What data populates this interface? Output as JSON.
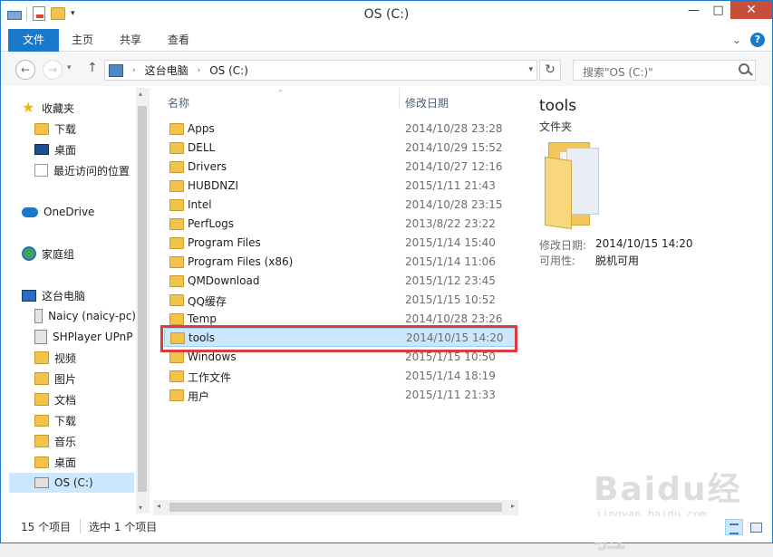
{
  "window": {
    "title": "OS (C:)"
  },
  "qat": {
    "dropdown_glyph": "▾"
  },
  "window_buttons": {
    "minimize": "—",
    "maximize": "□",
    "close": "✕"
  },
  "ribbon": {
    "tabs": [
      {
        "label": "文件"
      },
      {
        "label": "主页"
      },
      {
        "label": "共享"
      },
      {
        "label": "查看"
      }
    ],
    "expand_glyph": "⌄",
    "help_glyph": "?"
  },
  "address": {
    "back_glyph": "←",
    "forward_glyph": "→",
    "recent_dropdown_glyph": "▾",
    "up_glyph": "↑",
    "path": [
      "这台电脑",
      "OS (C:)"
    ],
    "chevron": "›",
    "dropdown_glyph": "▾",
    "refresh_glyph": "↻",
    "search_placeholder": "搜索\"OS (C:)\""
  },
  "navpane": {
    "items": [
      {
        "label": "收藏夹",
        "icon": "star-icon"
      },
      {
        "label": "下载",
        "icon": "folder-icon"
      },
      {
        "label": "桌面",
        "icon": "desktop-icon"
      },
      {
        "label": "最近访问的位置",
        "icon": "recent-places-icon"
      },
      {
        "label": "OneDrive",
        "icon": "onedrive-icon"
      },
      {
        "label": "家庭组",
        "icon": "homegroup-icon"
      },
      {
        "label": "这台电脑",
        "icon": "computer-icon"
      },
      {
        "label": "Naicy (naicy-pc)",
        "icon": "media-device-icon"
      },
      {
        "label": "SHPlayer UPnP",
        "icon": "media-device-icon"
      },
      {
        "label": "视频",
        "icon": "videos-folder-icon"
      },
      {
        "label": "图片",
        "icon": "pictures-folder-icon"
      },
      {
        "label": "文档",
        "icon": "documents-folder-icon"
      },
      {
        "label": "下载",
        "icon": "downloads-folder-icon"
      },
      {
        "label": "音乐",
        "icon": "music-folder-icon"
      },
      {
        "label": "桌面",
        "icon": "desktop-folder-icon"
      },
      {
        "label": "OS (C:)",
        "icon": "drive-icon"
      }
    ],
    "scroll_up_glyph": "▴",
    "scroll_down_glyph": "▾"
  },
  "filelist": {
    "columns": {
      "name": "名称",
      "date": "修改日期",
      "sort_glyph": "^"
    },
    "rows": [
      {
        "name": "Apps",
        "date": "2014/10/28 23:28"
      },
      {
        "name": "DELL",
        "date": "2014/10/29 15:52"
      },
      {
        "name": "Drivers",
        "date": "2014/10/27 12:16"
      },
      {
        "name": "HUBDNZI",
        "date": "2015/1/11 21:43"
      },
      {
        "name": "Intel",
        "date": "2014/10/28 23:15"
      },
      {
        "name": "PerfLogs",
        "date": "2013/8/22 23:22"
      },
      {
        "name": "Program Files",
        "date": "2015/1/14 15:40"
      },
      {
        "name": "Program Files (x86)",
        "date": "2015/1/14 11:06"
      },
      {
        "name": "QMDownload",
        "date": "2015/1/12 23:45"
      },
      {
        "name": "QQ缓存",
        "date": "2015/1/15 10:52"
      },
      {
        "name": "Temp",
        "date": "2014/10/28 23:26"
      },
      {
        "name": "tools",
        "date": "2014/10/15 14:20"
      },
      {
        "name": "Windows",
        "date": "2015/1/15 10:50"
      },
      {
        "name": "工作文件",
        "date": "2015/1/14 18:19"
      },
      {
        "name": "用户",
        "date": "2015/1/11 21:33"
      }
    ],
    "scroll_left_glyph": "◂",
    "scroll_right_glyph": "▸"
  },
  "details": {
    "title": "tools",
    "type": "文件夹",
    "modified_label": "修改日期:",
    "modified_value": "2014/10/15 14:20",
    "availability_label": "可用性:",
    "availability_value": "脱机可用"
  },
  "status": {
    "item_count": "15 个项目",
    "selected": "选中 1 个项目"
  },
  "watermark": {
    "logo_text": "Baidu经验",
    "url": "jingyan.baidu.com"
  },
  "colors": {
    "accent": "#1979ca",
    "selection": "#cce8ff",
    "highlight_box": "#e23a3a",
    "folder": "#f1c34d"
  }
}
